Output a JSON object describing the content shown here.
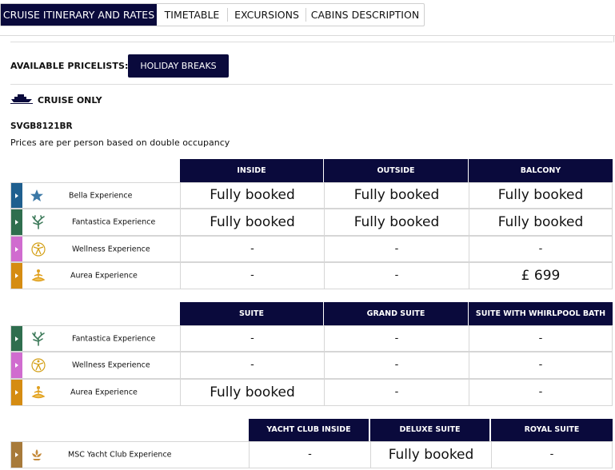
{
  "tabs": [
    {
      "label": "CRUISE ITINERARY AND RATES",
      "active": true
    },
    {
      "label": "TIMETABLE",
      "active": false
    },
    {
      "label": "EXCURSIONS",
      "active": false
    },
    {
      "label": "CABINS DESCRIPTION",
      "active": false
    }
  ],
  "pricelists": {
    "label": "AVAILABLE PRICELISTS:",
    "selected": "HOLIDAY BREAKS"
  },
  "cruise_only": {
    "label": "CRUISE ONLY",
    "icon": "ship-icon"
  },
  "code": "SVGB8121BR",
  "note": "Prices are per person based on double occupancy",
  "colors": {
    "navy": "#0a0a3c",
    "bella": "#1f5f8f",
    "fantastica": "#2f6e4e",
    "wellness": "#d06ccf",
    "aurea": "#d58c12",
    "yacht": "#a77a3a"
  },
  "table1": {
    "headers": [
      "INSIDE",
      "OUTSIDE",
      "BALCONY"
    ],
    "rows": [
      {
        "name": "Bella Experience",
        "icon": "star-icon",
        "cells": [
          "Fully booked",
          "Fully booked",
          "Fully booked"
        ]
      },
      {
        "name": "Fantastica Experience",
        "icon": "coral-icon",
        "cells": [
          "Fully booked",
          "Fully booked",
          "Fully booked"
        ]
      },
      {
        "name": "Wellness Experience",
        "icon": "wellness-figure-icon",
        "cells": [
          "-",
          "-",
          "-"
        ]
      },
      {
        "name": "Aurea Experience",
        "icon": "lotus-figure-icon",
        "cells": [
          "-",
          "-",
          "£ 699"
        ]
      }
    ]
  },
  "table2": {
    "headers": [
      "SUITE",
      "GRAND SUITE",
      "SUITE WITH WHIRLPOOL BATH"
    ],
    "rows": [
      {
        "name": "Fantastica Experience",
        "icon": "coral-icon",
        "cells": [
          "-",
          "-",
          "-"
        ]
      },
      {
        "name": "Wellness Experience",
        "icon": "wellness-figure-icon",
        "cells": [
          "-",
          "-",
          "-"
        ]
      },
      {
        "name": "Aurea Experience",
        "icon": "lotus-figure-icon",
        "cells": [
          "Fully booked",
          "-",
          "-"
        ]
      }
    ]
  },
  "table3": {
    "headers": [
      "YACHT CLUB INSIDE",
      "DELUXE SUITE",
      "ROYAL SUITE"
    ],
    "rows": [
      {
        "name": "MSC Yacht Club Experience",
        "icon": "yacht-club-icon",
        "cells": [
          "-",
          "Fully booked",
          "-"
        ]
      }
    ]
  }
}
